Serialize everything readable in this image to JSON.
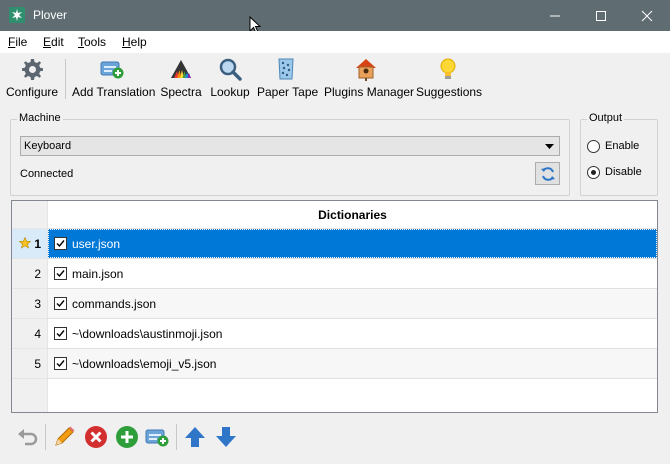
{
  "window": {
    "title": "Plover",
    "minimize_icon": "minimize-icon",
    "maximize_icon": "maximize-icon",
    "close_icon": "close-icon"
  },
  "menu": [
    {
      "label": "File",
      "underline": "F",
      "rest": "ile"
    },
    {
      "label": "Edit",
      "underline": "E",
      "rest": "dit"
    },
    {
      "label": "Tools",
      "underline": "T",
      "rest": "ools"
    },
    {
      "label": "Help",
      "underline": "H",
      "rest": "elp"
    }
  ],
  "toolbar": {
    "configure": "Configure",
    "add_translation": "Add Translation",
    "spectra": "Spectra",
    "lookup": "Lookup",
    "paper_tape": "Paper Tape",
    "plugins_manager": "Plugins Manager",
    "suggestions": "Suggestions"
  },
  "machine": {
    "group_title": "Machine",
    "selected": "Keyboard",
    "status": "Connected"
  },
  "output": {
    "group_title": "Output",
    "options": [
      "Enable",
      "Disable"
    ],
    "selected": "Disable"
  },
  "dictionaries": {
    "header": "Dictionaries",
    "rows": [
      {
        "index": "1",
        "path": "user.json",
        "enabled": true,
        "selected": true,
        "favorite": true
      },
      {
        "index": "2",
        "path": "main.json",
        "enabled": true,
        "selected": false,
        "favorite": false
      },
      {
        "index": "3",
        "path": "commands.json",
        "enabled": true,
        "selected": false,
        "favorite": false
      },
      {
        "index": "4",
        "path": "~\\downloads\\austinmoji.json",
        "enabled": true,
        "selected": false,
        "favorite": false
      },
      {
        "index": "5",
        "path": "~\\downloads\\emoji_v5.json",
        "enabled": true,
        "selected": false,
        "favorite": false
      }
    ]
  },
  "bottom_toolbar": [
    "undo-icon",
    "edit-pencil-icon",
    "remove-icon",
    "add-icon",
    "add-translation-icon",
    "move-up-icon",
    "move-down-icon"
  ],
  "colors": {
    "titlebar": "#5f6c72",
    "selection": "#0078d7",
    "remove": "#d32f2f",
    "add": "#2e9e3a",
    "arrow": "#2f76c8"
  }
}
